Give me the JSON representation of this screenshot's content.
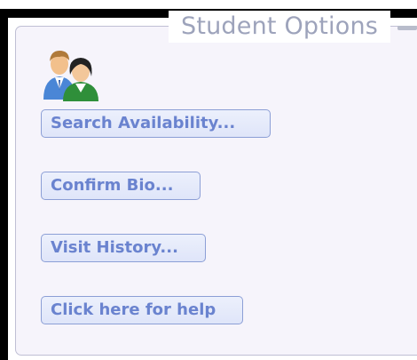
{
  "panel": {
    "title": "Student Options",
    "icon": "people-icon"
  },
  "options": [
    {
      "label": "Search Availability..."
    },
    {
      "label": "Confirm Bio..."
    },
    {
      "label": "Visit History..."
    },
    {
      "label": "Click here for help"
    }
  ],
  "colors": {
    "accent": "#6a83cf",
    "button_border": "#8c9fd6",
    "title": "#9da3bb",
    "panel_bg": "#f6f4fb"
  }
}
